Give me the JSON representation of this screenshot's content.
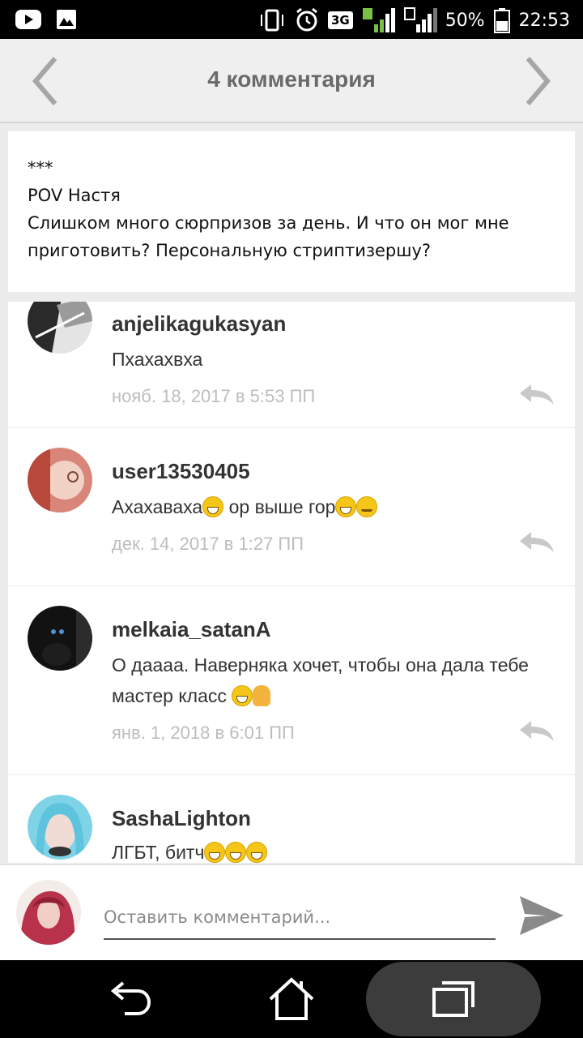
{
  "status_bar": {
    "network": "3G",
    "battery": "50%",
    "time": "22:53",
    "icons": [
      "youtube-icon",
      "gallery-icon",
      "vibrate-icon",
      "alarm-icon",
      "signal-1-icon",
      "signal-2-icon",
      "battery-icon"
    ]
  },
  "header": {
    "title": "4 комментария"
  },
  "excerpt": {
    "line1": "***",
    "line2": "POV Настя",
    "line3": "Слишком много сюрпризов за день. И что он мог мне приготовить? Персональную стриптизершу?"
  },
  "comments": [
    {
      "user": "anjelikagukasyan",
      "text": "Пхахахвха",
      "date": "нояб. 18, 2017 в 5:53 ПП"
    },
    {
      "user": "user13530405",
      "text_a": "Ахахаваха",
      "text_b": " ор выше гор",
      "date": "дек. 14, 2017 в 1:27 ПП"
    },
    {
      "user": "melkaia_satanA",
      "text": "О даааа. Наверняка хочет, чтобы она дала тебе мастер класс ",
      "date": "янв. 1, 2018 в 6:01 ПП"
    },
    {
      "user": "SashaLighton",
      "text": "ЛГБТ, битч",
      "date": ""
    }
  ],
  "input": {
    "placeholder": "Оставить комментарий..."
  },
  "colors": {
    "header_bg": "#efefef",
    "title": "#6a6a6a",
    "date": "#bdbdbd",
    "status_bar": "#000000"
  }
}
